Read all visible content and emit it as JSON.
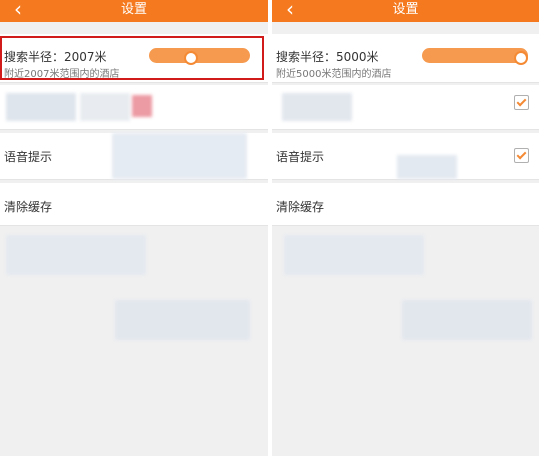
{
  "left": {
    "title": "设置",
    "back_icon": "chevron-left-icon",
    "radius": {
      "label": "搜索半径：2007米",
      "sub": "附近2007米范围内的酒店",
      "value": 2007
    },
    "voice_label": "语音提示",
    "cache_label": "清除缓存"
  },
  "right": {
    "title": "设置",
    "back_icon": "chevron-left-icon",
    "radius": {
      "label": "搜索半径：5000米",
      "sub": "附近5000米范围内的酒店",
      "value": 5000
    },
    "voice_label": "语音提示",
    "cache_label": "清除缓存"
  },
  "colors": {
    "accent": "#f57a1f",
    "highlight": "#d11a1a"
  }
}
